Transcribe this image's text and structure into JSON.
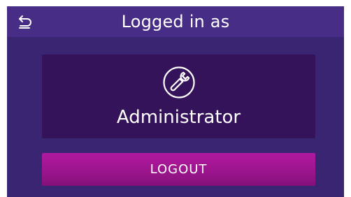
{
  "header": {
    "title": "Logged in as",
    "back_icon": "back-arrow-icon"
  },
  "user": {
    "icon": "wrench-icon",
    "role": "Administrator"
  },
  "actions": {
    "logout_label": "LOGOUT"
  },
  "colors": {
    "background": "#3a2572",
    "header": "#482d86",
    "card": "#35135a",
    "logout_button": "#a8179a",
    "text": "#ffffff"
  }
}
